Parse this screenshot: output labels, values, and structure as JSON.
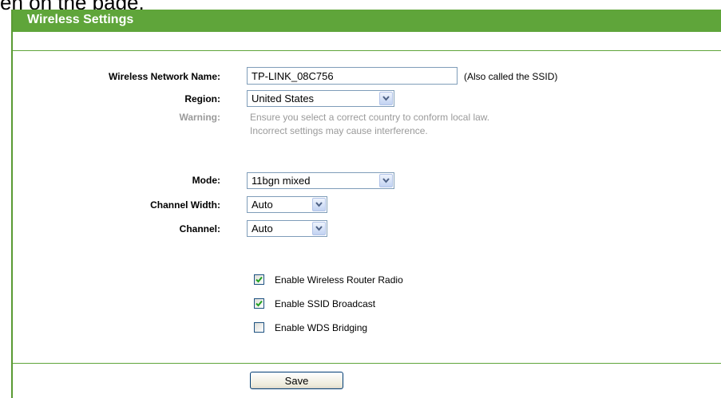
{
  "top_fragment": "en on the page.",
  "header": {
    "title": "Wireless Settings"
  },
  "form": {
    "ssid": {
      "label": "Wireless Network Name:",
      "value": "TP-LINK_08C756",
      "note": "(Also called the SSID)"
    },
    "region": {
      "label": "Region:",
      "selected": "United States"
    },
    "warning": {
      "label": "Warning:",
      "lines": [
        "Ensure you select a correct country to conform local law.",
        "Incorrect settings may cause interference."
      ]
    },
    "mode": {
      "label": "Mode:",
      "selected": "11bgn mixed"
    },
    "channel_width": {
      "label": "Channel Width:",
      "selected": "Auto"
    },
    "channel": {
      "label": "Channel:",
      "selected": "Auto"
    },
    "options": [
      {
        "label": "Enable Wireless Router Radio",
        "checked": true
      },
      {
        "label": "Enable SSID Broadcast",
        "checked": true
      },
      {
        "label": "Enable WDS Bridging",
        "checked": false
      }
    ]
  },
  "actions": {
    "save_label": "Save"
  },
  "colors": {
    "accent_green": "#5fa53a",
    "warning_gray": "#9a9a9a",
    "input_border": "#7f9db9"
  }
}
